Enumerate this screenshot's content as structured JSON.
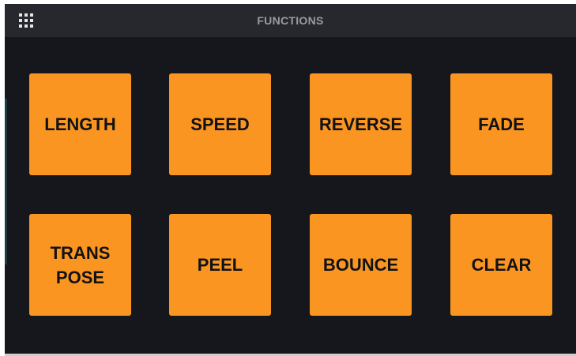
{
  "header": {
    "title": "FUNCTIONS",
    "menu_icon": "grid-menu-icon"
  },
  "pads": [
    {
      "id": "length",
      "label": "LENGTH"
    },
    {
      "id": "speed",
      "label": "SPEED"
    },
    {
      "id": "reverse",
      "label": "REVERSE"
    },
    {
      "id": "fade",
      "label": "FADE"
    },
    {
      "id": "transpose",
      "label": "TRANS\nPOSE"
    },
    {
      "id": "peel",
      "label": "PEEL"
    },
    {
      "id": "bounce",
      "label": "BOUNCE"
    },
    {
      "id": "clear",
      "label": "CLEAR"
    }
  ],
  "colors": {
    "background": "#16171d",
    "header": "#27282e",
    "pad": "#fb9521",
    "pad_text": "#111214",
    "title_text": "#9a9aa0"
  }
}
